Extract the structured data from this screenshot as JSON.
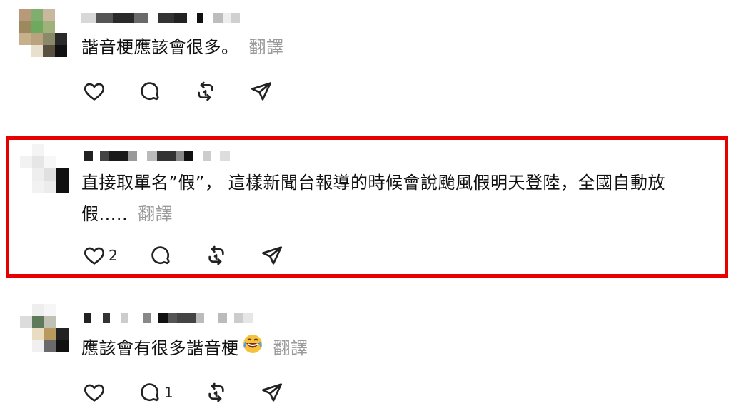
{
  "posts": [
    {
      "text": "諧音梗應該會很多。",
      "translate_label": "翻譯",
      "likes": "",
      "comments": "",
      "highlighted": false
    },
    {
      "text_line1": "直接取單名”假”， 這樣新聞台報導的時候會說颱風假明天登陸，全國自動放",
      "text_line2": "假.....",
      "translate_label": "翻譯",
      "likes": "2",
      "comments": "",
      "highlighted": true
    },
    {
      "text": "應該會有很多諧音梗",
      "emoji": "rolling-on-floor-laughing-emoji",
      "translate_label": "翻譯",
      "likes": "",
      "comments": "1",
      "highlighted": false
    }
  ],
  "icons": {
    "like": "heart-icon",
    "comment": "comment-bubble-icon",
    "repost": "repost-icon",
    "share": "send-icon"
  },
  "colors": {
    "highlight_border": "#e60000",
    "translate_text": "#9a9a9a",
    "divider": "#dddddd"
  }
}
